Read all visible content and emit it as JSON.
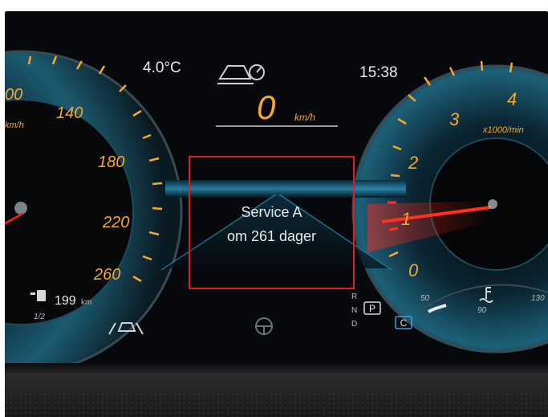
{
  "top_bar": {
    "temperature": "4.0°C",
    "clock": "15:38"
  },
  "speed": {
    "value": "0",
    "unit": "km/h"
  },
  "speedometer": {
    "ticks": [
      "00",
      "140",
      "180",
      "220",
      "260"
    ],
    "unit": "km/h",
    "range_value": "199",
    "range_unit": "km",
    "fuel_fraction": "1/2"
  },
  "tachometer": {
    "ticks": [
      "0",
      "1",
      "2",
      "3",
      "4"
    ],
    "unit": "x1000/min"
  },
  "message": {
    "line1": "Service A",
    "line2": "om 261 dager"
  },
  "gear": {
    "letters": [
      "R",
      "N",
      "D"
    ],
    "selected": "P",
    "mode": "C"
  },
  "temp_gauge": {
    "min": "50",
    "mid": "90",
    "max": "130"
  },
  "colors": {
    "accent_orange": "#f7a928",
    "highlight_red": "#e02020",
    "gauge_blue": "#1b6f8c"
  },
  "icons": [
    "driving-assist-icon",
    "fuel-pump-icon",
    "lane-assist-icon",
    "steering-wheel-icon",
    "coolant-temp-icon"
  ]
}
